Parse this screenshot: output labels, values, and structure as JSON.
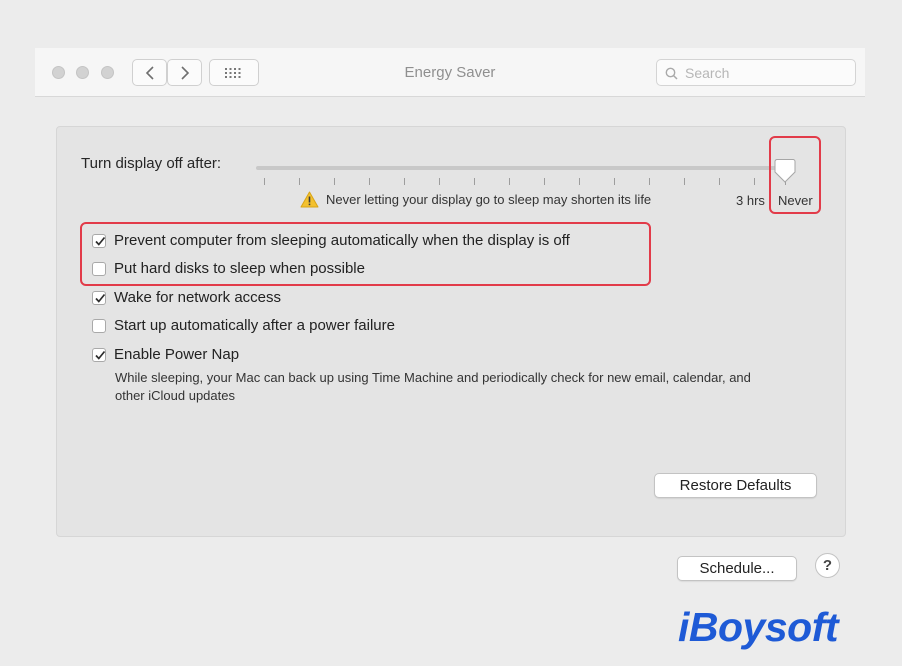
{
  "window": {
    "title": "Energy Saver",
    "search_placeholder": "Search"
  },
  "slider": {
    "label": "Turn display off after:",
    "warning": "Never letting your display go to sleep may shorten its life",
    "tick_labels": [
      "3 hrs",
      "Never"
    ],
    "selected": "Never"
  },
  "options": [
    {
      "label": "Prevent computer from sleeping automatically when the display is off",
      "checked": true
    },
    {
      "label": "Put hard disks to sleep when possible",
      "checked": false
    },
    {
      "label": "Wake for network access",
      "checked": true
    },
    {
      "label": "Start up automatically after a power failure",
      "checked": false
    },
    {
      "label": "Enable Power Nap",
      "checked": true
    }
  ],
  "power_nap_description": "While sleeping, your Mac can back up using Time Machine and periodically check for new email, calendar, and other iCloud updates",
  "buttons": {
    "restore_defaults": "Restore Defaults",
    "schedule": "Schedule...",
    "help": "?"
  },
  "watermark": "iBoysoft",
  "colors": {
    "highlight": "#e23b49",
    "watermark": "#1e5ad6"
  }
}
